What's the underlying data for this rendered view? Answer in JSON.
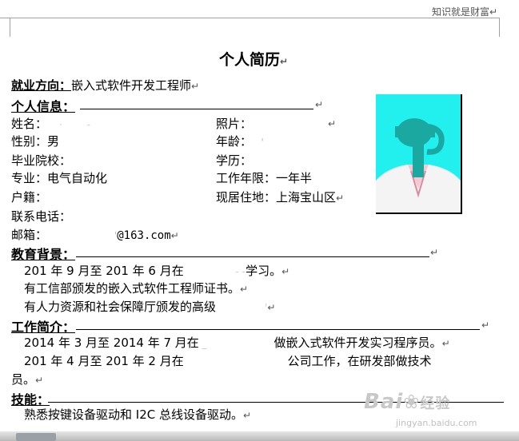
{
  "header": {
    "running_text": "知识就是财富"
  },
  "marks": {
    "para": "↵"
  },
  "resume": {
    "title": "个人简历",
    "job_direction": {
      "label": "就业方向：",
      "value": "嵌入式软件开发工程师"
    },
    "personal_info": {
      "heading": "个人信息：",
      "name_label": "姓名：",
      "photo_label": "照片：",
      "gender": "性别：男",
      "age_label": "年龄：",
      "school_label": "毕业院校：",
      "degree_label": "学历：",
      "major": "专业：电气自动化",
      "work_years": "工作年限：一年半",
      "hukou_label": "户籍：",
      "residence": "现居住地：上海宝山区",
      "phone_label": "联系电话：",
      "email_label": "邮箱：",
      "email_suffix": "@163.com"
    },
    "education": {
      "heading": "教育背景：",
      "line1_a": "201  年 9 月至 201  年 6 月在",
      "line1_b": "学习。",
      "line2": "有工信部颁发的嵌入式软件工程师证书。",
      "line3": "有人力资源和社会保障厅颁发的高级"
    },
    "work": {
      "heading": "工作简介：",
      "line1_a": "2014 年 3 月至 2014 年 7 月在",
      "line1_b": "做嵌入式软件开发实习程序员。",
      "line2_a": "201  年 4 月至 201  年 2 月在",
      "line2_b": "公司工作，在研发部做技术",
      "line3": "员。"
    },
    "skills": {
      "heading": "技能：",
      "line1": "熟悉按键设备驱动和 I2C 总线设备驱动。"
    }
  },
  "watermark": {
    "brand": "Bai",
    "brand2": "经验",
    "url": "jingyan.baidu.com"
  },
  "colors": {
    "photo_bg": "#22f0ef",
    "figure": "#1aa8a0"
  }
}
